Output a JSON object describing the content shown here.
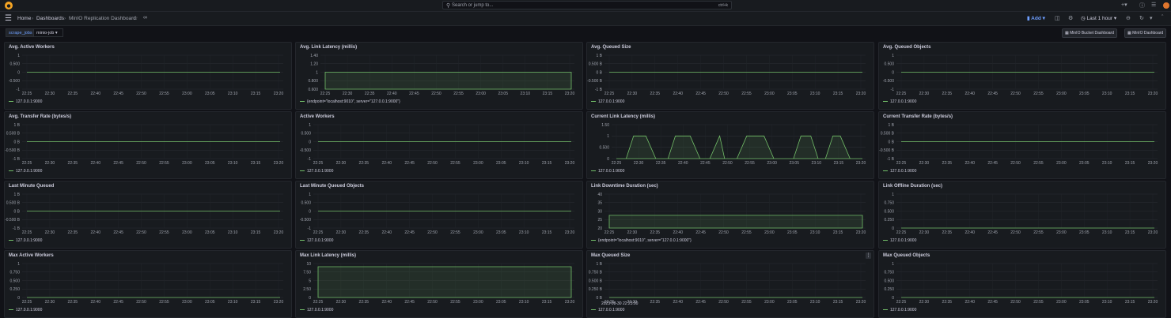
{
  "topbar": {
    "search_placeholder": "Search or jump to...",
    "search_shortcut": "ctrl+k",
    "icons": [
      "grafana-logo-icon",
      "search-icon",
      "plus-icon",
      "help-icon",
      "rss-icon",
      "user-avatar"
    ]
  },
  "navbar": {
    "breadcrumbs": [
      "Home",
      "Dashboards",
      "MinIO Replication Dashboard"
    ],
    "add_label": "Add",
    "time_range": "Last 1 hour"
  },
  "variables": {
    "label": "scrape_jobs",
    "value": "minio-job",
    "links": [
      "MinIO Bucket Dashboard",
      "MinIO Dashboard"
    ]
  },
  "colors": {
    "series": "#73bf69",
    "background": "#111217",
    "panel": "#181b1f",
    "accent": "#6e9fff"
  },
  "x_ticks": [
    "22:25",
    "22:30",
    "22:35",
    "22:40",
    "22:45",
    "22:50",
    "22:55",
    "23:00",
    "23:05",
    "23:10",
    "23:15",
    "23:20"
  ],
  "panels": [
    {
      "title": "Avg. Active Workers",
      "yticks": [
        "1",
        "0.500",
        "0",
        "-0.500",
        "-1"
      ],
      "legend": "127.0.0.1:9000",
      "shape": "flat"
    },
    {
      "title": "Avg. Link Latency (millis)",
      "yticks": [
        "1.40",
        "1.20",
        "1",
        "0.800",
        "0.600"
      ],
      "legend": "{endpoint=\"localhost:9010\", server=\"127.0.0.1:9000\"}",
      "shape": "area"
    },
    {
      "title": "Avg. Queued Size",
      "yticks": [
        "1 B",
        "0.500 B",
        "0 B",
        "-0.500 B",
        "-1 B"
      ],
      "legend": "127.0.0.1:9000",
      "shape": "flat"
    },
    {
      "title": "Avg. Queued Objects",
      "yticks": [
        "1",
        "0.500",
        "0",
        "-0.500",
        "-1"
      ],
      "legend": "127.0.0.1:9000",
      "shape": "flat"
    },
    {
      "title": "Avg. Transfer Rate (bytes/s)",
      "yticks": [
        "1 B",
        "0.500 B",
        "0 B",
        "-0.500 B",
        "-1 B"
      ],
      "legend": "127.0.0.1:9000",
      "shape": "flat"
    },
    {
      "title": "Active Workers",
      "yticks": [
        "1",
        "0.500",
        "0",
        "-0.500",
        "-1"
      ],
      "legend": "127.0.0.1:9000",
      "shape": "flat"
    },
    {
      "title": "Current Link Latency (millis)",
      "yticks": [
        "1.50",
        "1",
        "0.500",
        "0"
      ],
      "legend": "127.0.0.1:9000",
      "shape": "wave"
    },
    {
      "title": "Current Transfer Rate (bytes/s)",
      "yticks": [
        "1 B",
        "0.500 B",
        "0 B",
        "-0.500 B",
        "-1 B"
      ],
      "legend": "127.0.0.1:9000",
      "shape": "flat"
    },
    {
      "title": "Last Minute Queued",
      "yticks": [
        "1 B",
        "0.500 B",
        "0 B",
        "-0.500 B",
        "-1 B"
      ],
      "legend": "127.0.0.1:9000",
      "shape": "flat"
    },
    {
      "title": "Last Minute Queued Objects",
      "yticks": [
        "1",
        "0.500",
        "0",
        "-0.500",
        "-1"
      ],
      "legend": "127.0.0.1:9000",
      "shape": "flat"
    },
    {
      "title": "Link Downtime Duration (sec)",
      "yticks": [
        "40",
        "35",
        "30",
        "25",
        "20"
      ],
      "legend": "{endpoint=\"localhost:9010\", server=\"127.0.0.1:9000\"}",
      "shape": "area30"
    },
    {
      "title": "Link Offline Duration (sec)",
      "yticks": [
        "1",
        "0.750",
        "0.500",
        "0.250",
        "0"
      ],
      "legend": "127.0.0.1:9000",
      "shape": "bottom"
    },
    {
      "title": "Max Active Workers",
      "yticks": [
        "1",
        "0.750",
        "0.500",
        "0.250",
        "0"
      ],
      "legend": "127.0.0.1:9000",
      "shape": "bottom"
    },
    {
      "title": "Max Link Latency (millis)",
      "yticks": [
        "10",
        "7.50",
        "5",
        "2.50",
        "0"
      ],
      "legend": "127.0.0.1:9000",
      "shape": "areaTop"
    },
    {
      "title": "Max Queued Size",
      "yticks": [
        "1 B",
        "0.750 B",
        "0.500 B",
        "0.250 B",
        "0 B"
      ],
      "legend": "127.0.0.1:9000",
      "shape": "bottom",
      "tooltip": "2023-08-30 22:23:00"
    },
    {
      "title": "Max Queued Objects",
      "yticks": [
        "1",
        "0.750",
        "0.500",
        "0.250",
        "0"
      ],
      "legend": "127.0.0.1:9000",
      "shape": "bottom"
    }
  ]
}
